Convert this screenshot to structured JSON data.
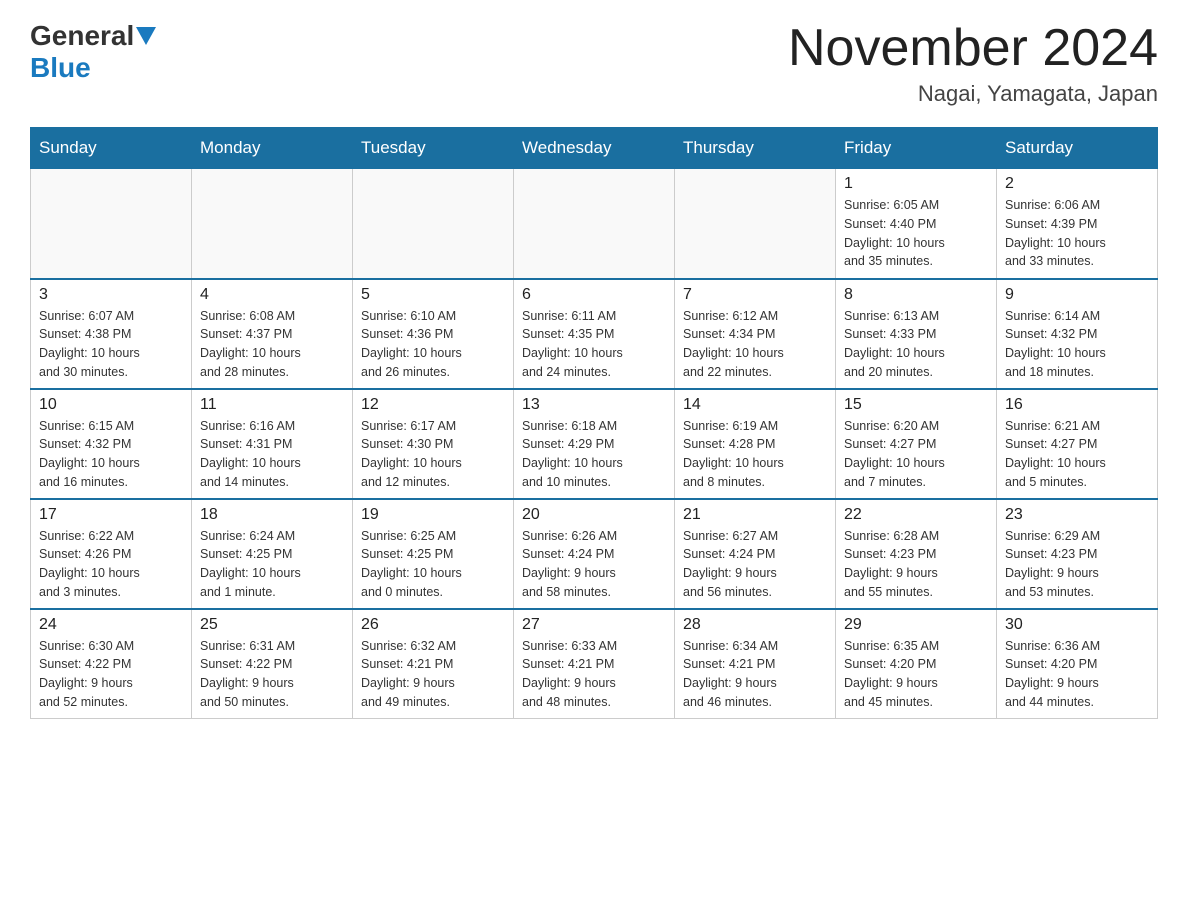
{
  "logo": {
    "general": "General",
    "blue": "Blue"
  },
  "title": "November 2024",
  "location": "Nagai, Yamagata, Japan",
  "weekdays": [
    "Sunday",
    "Monday",
    "Tuesday",
    "Wednesday",
    "Thursday",
    "Friday",
    "Saturday"
  ],
  "weeks": [
    [
      {
        "day": "",
        "info": ""
      },
      {
        "day": "",
        "info": ""
      },
      {
        "day": "",
        "info": ""
      },
      {
        "day": "",
        "info": ""
      },
      {
        "day": "",
        "info": ""
      },
      {
        "day": "1",
        "info": "Sunrise: 6:05 AM\nSunset: 4:40 PM\nDaylight: 10 hours\nand 35 minutes."
      },
      {
        "day": "2",
        "info": "Sunrise: 6:06 AM\nSunset: 4:39 PM\nDaylight: 10 hours\nand 33 minutes."
      }
    ],
    [
      {
        "day": "3",
        "info": "Sunrise: 6:07 AM\nSunset: 4:38 PM\nDaylight: 10 hours\nand 30 minutes."
      },
      {
        "day": "4",
        "info": "Sunrise: 6:08 AM\nSunset: 4:37 PM\nDaylight: 10 hours\nand 28 minutes."
      },
      {
        "day": "5",
        "info": "Sunrise: 6:10 AM\nSunset: 4:36 PM\nDaylight: 10 hours\nand 26 minutes."
      },
      {
        "day": "6",
        "info": "Sunrise: 6:11 AM\nSunset: 4:35 PM\nDaylight: 10 hours\nand 24 minutes."
      },
      {
        "day": "7",
        "info": "Sunrise: 6:12 AM\nSunset: 4:34 PM\nDaylight: 10 hours\nand 22 minutes."
      },
      {
        "day": "8",
        "info": "Sunrise: 6:13 AM\nSunset: 4:33 PM\nDaylight: 10 hours\nand 20 minutes."
      },
      {
        "day": "9",
        "info": "Sunrise: 6:14 AM\nSunset: 4:32 PM\nDaylight: 10 hours\nand 18 minutes."
      }
    ],
    [
      {
        "day": "10",
        "info": "Sunrise: 6:15 AM\nSunset: 4:32 PM\nDaylight: 10 hours\nand 16 minutes."
      },
      {
        "day": "11",
        "info": "Sunrise: 6:16 AM\nSunset: 4:31 PM\nDaylight: 10 hours\nand 14 minutes."
      },
      {
        "day": "12",
        "info": "Sunrise: 6:17 AM\nSunset: 4:30 PM\nDaylight: 10 hours\nand 12 minutes."
      },
      {
        "day": "13",
        "info": "Sunrise: 6:18 AM\nSunset: 4:29 PM\nDaylight: 10 hours\nand 10 minutes."
      },
      {
        "day": "14",
        "info": "Sunrise: 6:19 AM\nSunset: 4:28 PM\nDaylight: 10 hours\nand 8 minutes."
      },
      {
        "day": "15",
        "info": "Sunrise: 6:20 AM\nSunset: 4:27 PM\nDaylight: 10 hours\nand 7 minutes."
      },
      {
        "day": "16",
        "info": "Sunrise: 6:21 AM\nSunset: 4:27 PM\nDaylight: 10 hours\nand 5 minutes."
      }
    ],
    [
      {
        "day": "17",
        "info": "Sunrise: 6:22 AM\nSunset: 4:26 PM\nDaylight: 10 hours\nand 3 minutes."
      },
      {
        "day": "18",
        "info": "Sunrise: 6:24 AM\nSunset: 4:25 PM\nDaylight: 10 hours\nand 1 minute."
      },
      {
        "day": "19",
        "info": "Sunrise: 6:25 AM\nSunset: 4:25 PM\nDaylight: 10 hours\nand 0 minutes."
      },
      {
        "day": "20",
        "info": "Sunrise: 6:26 AM\nSunset: 4:24 PM\nDaylight: 9 hours\nand 58 minutes."
      },
      {
        "day": "21",
        "info": "Sunrise: 6:27 AM\nSunset: 4:24 PM\nDaylight: 9 hours\nand 56 minutes."
      },
      {
        "day": "22",
        "info": "Sunrise: 6:28 AM\nSunset: 4:23 PM\nDaylight: 9 hours\nand 55 minutes."
      },
      {
        "day": "23",
        "info": "Sunrise: 6:29 AM\nSunset: 4:23 PM\nDaylight: 9 hours\nand 53 minutes."
      }
    ],
    [
      {
        "day": "24",
        "info": "Sunrise: 6:30 AM\nSunset: 4:22 PM\nDaylight: 9 hours\nand 52 minutes."
      },
      {
        "day": "25",
        "info": "Sunrise: 6:31 AM\nSunset: 4:22 PM\nDaylight: 9 hours\nand 50 minutes."
      },
      {
        "day": "26",
        "info": "Sunrise: 6:32 AM\nSunset: 4:21 PM\nDaylight: 9 hours\nand 49 minutes."
      },
      {
        "day": "27",
        "info": "Sunrise: 6:33 AM\nSunset: 4:21 PM\nDaylight: 9 hours\nand 48 minutes."
      },
      {
        "day": "28",
        "info": "Sunrise: 6:34 AM\nSunset: 4:21 PM\nDaylight: 9 hours\nand 46 minutes."
      },
      {
        "day": "29",
        "info": "Sunrise: 6:35 AM\nSunset: 4:20 PM\nDaylight: 9 hours\nand 45 minutes."
      },
      {
        "day": "30",
        "info": "Sunrise: 6:36 AM\nSunset: 4:20 PM\nDaylight: 9 hours\nand 44 minutes."
      }
    ]
  ]
}
